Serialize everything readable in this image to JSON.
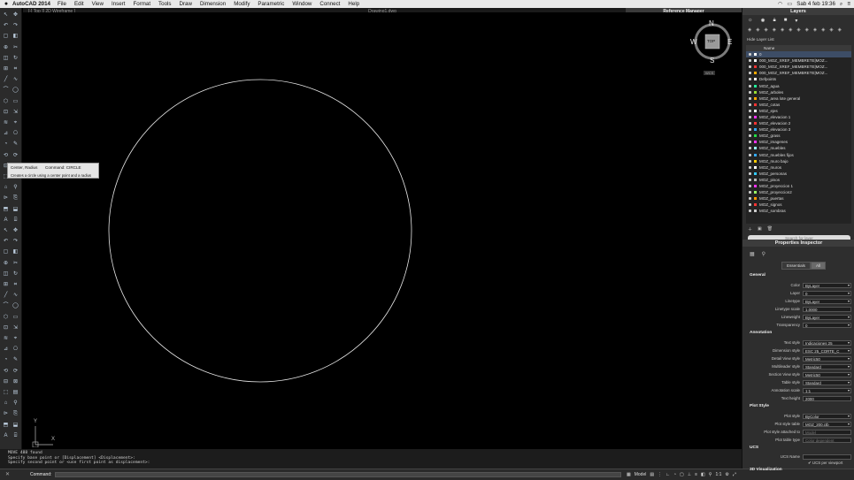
{
  "menubar": {
    "apple": "",
    "app": "AutoCAD 2014",
    "items": [
      "File",
      "Edit",
      "View",
      "Insert",
      "Format",
      "Tools",
      "Draw",
      "Dimension",
      "Modify",
      "Parametric",
      "Window",
      "Connect",
      "Help"
    ],
    "clock": "Sab 4 feb 19:36"
  },
  "drawing": {
    "view_label": "[-] Top ][ 2D Wireframe ]",
    "title": "Drawing1.dwg",
    "viewcube": {
      "n": "N",
      "s": "S",
      "e": "E",
      "w": "W",
      "face": "TOP",
      "wcs": "WCS"
    }
  },
  "reference_manager": "Reference Manager",
  "tooltip": {
    "title": "Center, Radius",
    "command": "Command: CIRCLE",
    "desc": "Creates a circle using a center point and a radius"
  },
  "command": {
    "history": [
      "MOVE 488 found",
      "Specify base point or [Displacement] <Displacement>:",
      "Specify second point or <use first point as displacement>:"
    ],
    "label": "Command:"
  },
  "statusbar": {
    "model": "Model",
    "scale": "1:1",
    "coords": "942.0869, 727.1998, 0.0000"
  },
  "ucs": {
    "y": "Y",
    "x": "X"
  },
  "layers": {
    "title": "Layers",
    "hide_list": "Hide Layer List",
    "col_name": "Name",
    "items": [
      "0",
      "000_MOZ_XREF_MEMBRETE|MOZ...",
      "000_MOZ_XREF_MEMBRETE|MOZ...",
      "000_MOZ_XREF_MEMBRETE|MOZ...",
      "Defpoints",
      "MOZ_agua",
      "MOZ_arboles",
      "MOZ_area lote general",
      "MOZ_cotas",
      "MOZ_ejes",
      "MOZ_elevacion 1",
      "MOZ_elevacion 2",
      "MOZ_elevacion 3",
      "MOZ_grass",
      "MOZ_imagenes",
      "MOZ_muebles",
      "MOZ_muebles fijos",
      "MOZ_muro bajo",
      "MOZ_muros",
      "MOZ_personas",
      "MOZ_pisos",
      "MOZ_proyeccion 1",
      "MOZ_proyeccion2",
      "MOZ_puertas",
      "MOZ_signos",
      "MOZ_sombras"
    ],
    "search_placeholder": "Search for layer"
  },
  "properties": {
    "title": "Properties Inspector",
    "tab_essentials": "Essentials",
    "tab_all": "All",
    "general": "General",
    "annotation": "Annotation",
    "plotstyle": "Plot Style",
    "ucs_section": "UCS",
    "viz": "3D Visualization",
    "rows": {
      "color": [
        "Color",
        "ByLayer"
      ],
      "layer": [
        "Layer",
        "0"
      ],
      "linetype": [
        "Linetype",
        "ByLayer"
      ],
      "ltscale": [
        "Linetype scale",
        "1.0000"
      ],
      "lweight": [
        "Lineweight",
        "ByLayer"
      ],
      "transp": [
        "Transparency",
        "0"
      ],
      "textstyle": [
        "Text style",
        "Indicaciones 25"
      ],
      "dimstyle": [
        "Dimension style",
        "ESC 25_CORTE_C"
      ],
      "detailview": [
        "Detail View style",
        "Metric50"
      ],
      "mleader": [
        "Multileader style",
        "Standard"
      ],
      "sectionview": [
        "Section View style",
        "Metric50"
      ],
      "tablestyle": [
        "Table style",
        "Standard"
      ],
      "annoscale": [
        "Annotation scale",
        "1:1"
      ],
      "textheight": [
        "Text height",
        "2000"
      ],
      "plotstyle": [
        "Plot style",
        "ByColor"
      ],
      "plottable": [
        "Plot style table",
        "MOZ_200.ctb"
      ],
      "plotattached": [
        "Plot style attached to",
        "Model"
      ],
      "plottype": [
        "Plot table type",
        "Color dependent"
      ],
      "ucsname": [
        "UCS Name",
        ""
      ],
      "ucsper": "UCS per viewport"
    }
  }
}
